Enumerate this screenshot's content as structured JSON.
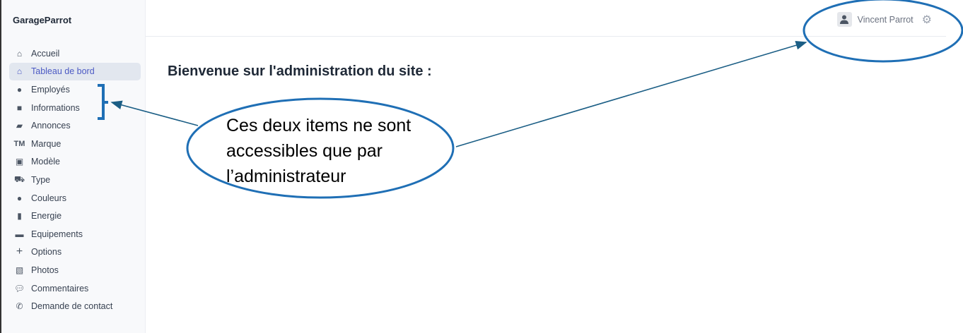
{
  "sidebar": {
    "brand": "GarageParrot",
    "items": [
      {
        "label": "Accueil",
        "icon": "house-lock-icon"
      },
      {
        "label": "Tableau de bord",
        "icon": "home-icon",
        "active": true
      },
      {
        "label": "Employés",
        "icon": "user-tie-icon"
      },
      {
        "label": "Informations",
        "icon": "book-icon"
      },
      {
        "label": "Annonces",
        "icon": "car-icon"
      },
      {
        "label": "Marque",
        "icon": "trademark-icon"
      },
      {
        "label": "Modèle",
        "icon": "id-card-icon"
      },
      {
        "label": "Type",
        "icon": "truck-monster-icon"
      },
      {
        "label": "Couleurs",
        "icon": "palette-icon"
      },
      {
        "label": "Energie",
        "icon": "gas-pump-icon"
      },
      {
        "label": "Equipements",
        "icon": "toolbox-icon"
      },
      {
        "label": "Options",
        "icon": "plus-icon"
      },
      {
        "label": "Photos",
        "icon": "photo-icon"
      },
      {
        "label": "Commentaires",
        "icon": "comment-icon"
      },
      {
        "label": "Demande de contact",
        "icon": "phone-icon"
      }
    ]
  },
  "header": {
    "user_name": "Vincent Parrot"
  },
  "main": {
    "title": "Bienvenue sur l'administration du site :"
  },
  "annotation": {
    "lines": [
      "Ces deux items ne sont",
      "accessibles que par",
      "l’administrateur"
    ],
    "color": "#1f6fb5"
  },
  "colors": {
    "accent": "#4c5ac4"
  }
}
